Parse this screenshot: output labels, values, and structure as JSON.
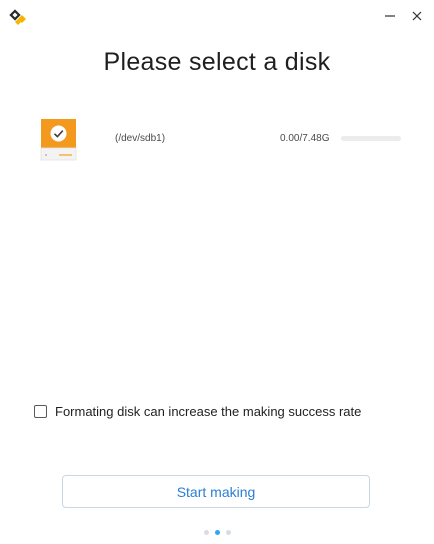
{
  "window": {
    "app_icon": "disk-burner-icon",
    "minimize_icon": "minimize-icon",
    "close_icon": "close-icon"
  },
  "page": {
    "title": "Please select a disk"
  },
  "disks": [
    {
      "icon": "usb-disk-icon",
      "selected": true,
      "path": "(/dev/sdb1)",
      "size": "0.00/7.48G",
      "usage_fraction": 0
    }
  ],
  "format_option": {
    "checked": false,
    "label": "Formating disk can increase the making success rate"
  },
  "actions": {
    "start_label": "Start making"
  },
  "pagination": {
    "total": 3,
    "current": 2
  },
  "colors": {
    "accent": "#2ca7f8",
    "disk_orange": "#f39a1e",
    "button_text": "#2a7fd4"
  }
}
